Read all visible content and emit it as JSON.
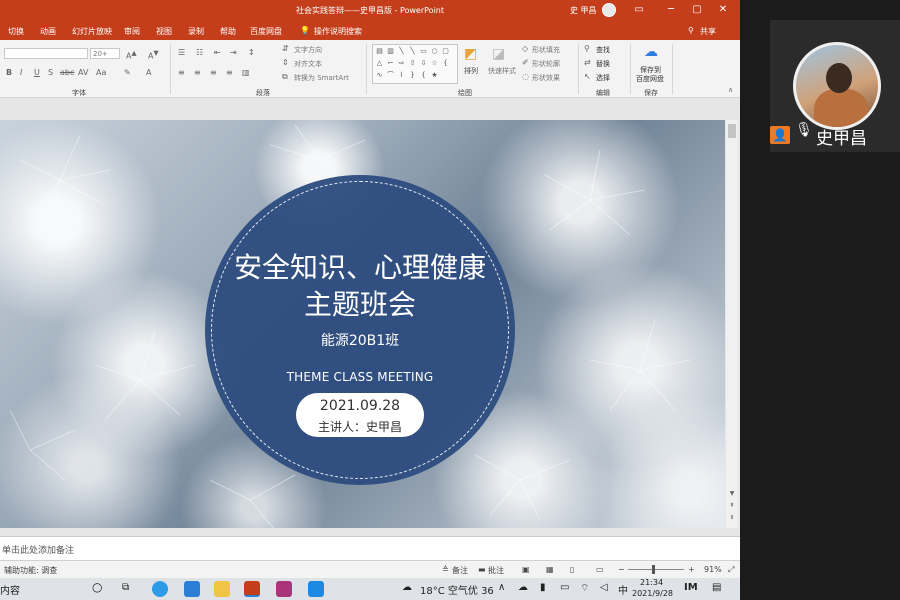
{
  "window": {
    "title": "社会实践答辩——史甲昌版 - PowerPoint",
    "user": "史 甲昌",
    "controls": [
      "▭",
      "─",
      "▢",
      "✕"
    ]
  },
  "menu": {
    "tabs": [
      "切换",
      "动画",
      "幻灯片放映",
      "审阅",
      "视图",
      "录制",
      "帮助",
      "百度网盘"
    ],
    "tell_me": "操作说明搜索",
    "share": "共享"
  },
  "ribbon": {
    "groups": [
      "字体",
      "段落",
      "绘图",
      "编辑",
      "保存"
    ],
    "font_size": "20+",
    "font_buttons": [
      "B",
      "I",
      "U",
      "S",
      "abc",
      "AV",
      "Aa",
      "A"
    ],
    "paragraph": {
      "text_direction": "文字方向",
      "align_text": "对齐文本",
      "smartart": "转换为 SmartArt"
    },
    "drawing": {
      "arrange": "排列",
      "quick_styles": "快速样式",
      "shape_fill": "形状填充",
      "shape_outline": "形状轮廓",
      "shape_effects": "形状效果"
    },
    "editing": {
      "find": "查找",
      "replace": "替换",
      "select": "选择"
    },
    "save": {
      "line1": "保存到",
      "line2": "百度网盘"
    }
  },
  "slide": {
    "title_line1": "安全知识、心理健康",
    "title_line2": "主题班会",
    "class_name": "能源20B1班",
    "subtitle_en": "THEME CLASS MEETING",
    "date": "2021.09.28",
    "speaker": "主讲人：史甲昌"
  },
  "notes": {
    "placeholder": "单击此处添加备注"
  },
  "status": {
    "accessibility": "辅助功能: 调查",
    "notes_btn": "备注",
    "comments_btn": "批注",
    "zoom": "91%"
  },
  "taskbar": {
    "left_text": "内容",
    "weather": "18°C 空气优 36",
    "ime": "中",
    "time": "21:34",
    "date": "2021/9/28"
  },
  "video": {
    "participant": "史甲昌"
  },
  "colors": {
    "ppt_brand": "#c43e1c",
    "slide_circle": "#2e4d7f",
    "badge_orange": "#f07a24",
    "mute_red": "#d9302c"
  }
}
